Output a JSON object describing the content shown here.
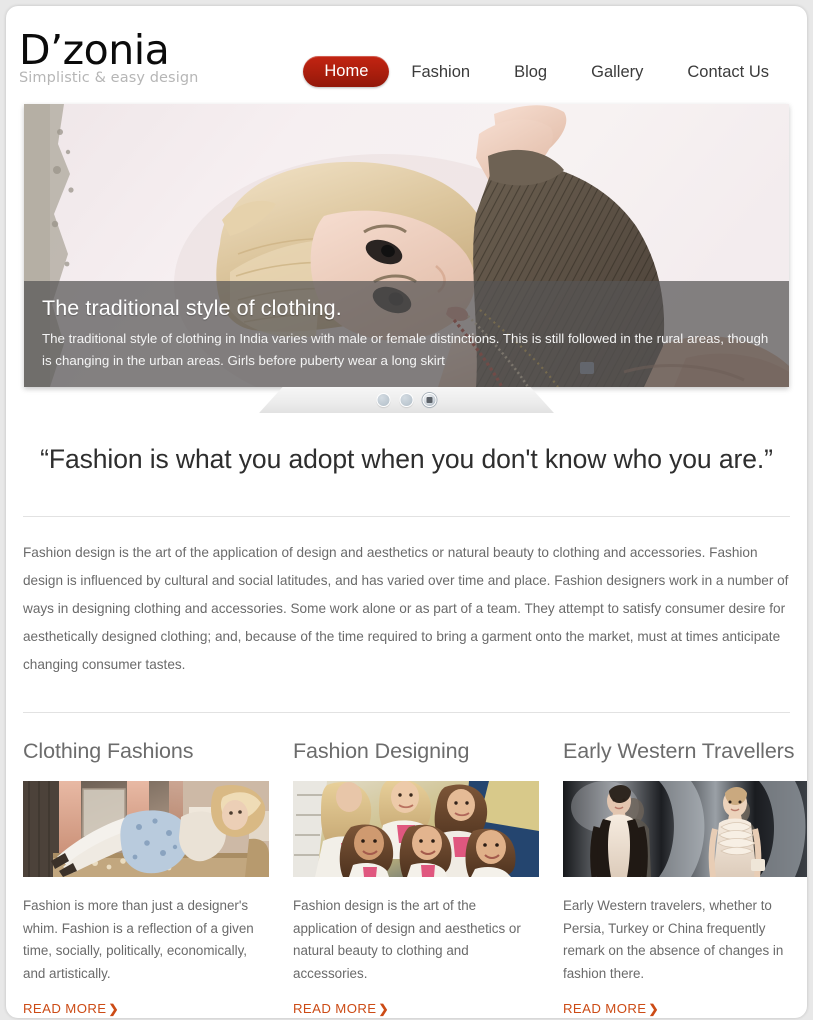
{
  "site": {
    "logo_title": "D’zonia",
    "logo_tagline": "Simplistic & easy design",
    "accent_color": "#aa1e0d",
    "link_color": "#cc4b15",
    "text_color": "#6a6a6a"
  },
  "nav": {
    "items": [
      {
        "label": "Home",
        "active": true
      },
      {
        "label": "Fashion",
        "active": false
      },
      {
        "label": "Blog",
        "active": false
      },
      {
        "label": "Gallery",
        "active": false
      },
      {
        "label": "Contact Us",
        "active": false
      }
    ]
  },
  "hero": {
    "title": "The traditional style of clothing.",
    "description": "The traditional style of clothing in India varies with male or female distinctions. This is still followed in the rural areas, though is changing in the urban areas. Girls before puberty wear a long skirt",
    "image_alt": "blonde fashion model reclining with arm raised, pinstripe top and beaded necklace",
    "slider": {
      "dots": [
        "slide-1",
        "slide-2",
        "slide-3"
      ],
      "active_index": 2
    }
  },
  "quote": {
    "text": "“Fashion is what you adopt when you don't know who you are.”"
  },
  "intro": {
    "paragraph": "Fashion design is the art of the application of design and aesthetics or natural beauty to clothing and accessories. Fashion design is influenced by cultural and social latitudes, and has varied over time and place. Fashion designers work in a number of ways in designing clothing and accessories. Some work alone or as part of a team. They attempt to satisfy consumer desire for aesthetically designed clothing; and, because of the time required to bring a garment onto the market, must at times anticipate changing consumer tastes."
  },
  "columns": [
    {
      "title": "Clothing Fashions",
      "image_alt": "vintage-toned photo of woman reclining in blue dress and white stockings",
      "text": "Fashion is more than just a designer's whim. Fashion is a reflection of a given time, socially, politically, economically, and artistically.",
      "read_more": "READ MORE",
      "chevron": "❯"
    },
    {
      "title": "Fashion Designing",
      "image_alt": "group of smiling models in white jackets with pink scarves",
      "text": "Fashion design is the art of the application of design and aesthetics or natural beauty to clothing and accessories.",
      "read_more": "READ MORE",
      "chevron": "❯"
    },
    {
      "title": "Early Western Travellers",
      "image_alt": "two models walking a runway in pale ruffled dresses",
      "text": "Early Western travelers, whether to Persia, Turkey or China frequently remark on the absence of changes in fashion there.",
      "read_more": "READ MORE",
      "chevron": "❯"
    }
  ]
}
